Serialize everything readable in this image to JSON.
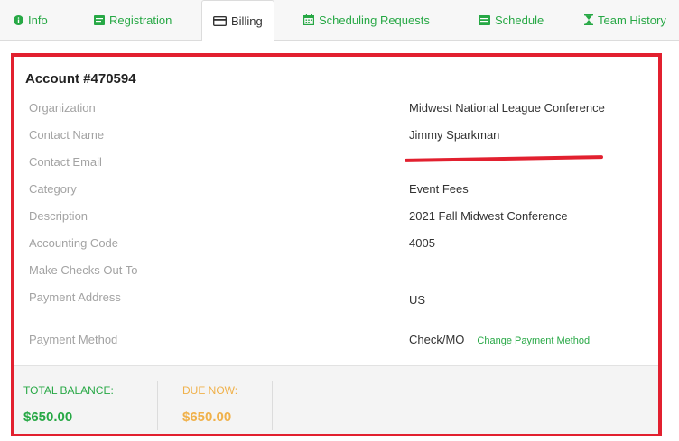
{
  "tabs": [
    {
      "label": "Info",
      "icon": "info-icon"
    },
    {
      "label": "Registration",
      "icon": "registration-icon"
    },
    {
      "label": "Billing",
      "icon": "credit-card-icon",
      "active": true
    },
    {
      "label": "Scheduling Requests",
      "icon": "calendar-icon"
    },
    {
      "label": "Schedule",
      "icon": "schedule-icon"
    },
    {
      "label": "Team History",
      "icon": "hourglass-icon"
    }
  ],
  "account": {
    "title": "Account #470594",
    "rows": [
      {
        "label": "Organization",
        "value": "Midwest National League Conference"
      },
      {
        "label": "Contact Name",
        "value": "Jimmy Sparkman"
      },
      {
        "label": "Contact Email",
        "value": "",
        "redacted": true
      },
      {
        "label": "Category",
        "value": "Event Fees"
      },
      {
        "label": "Description",
        "value": "2021 Fall Midwest Conference"
      },
      {
        "label": "Accounting Code",
        "value": "4005"
      },
      {
        "label": "Make Checks Out To",
        "value": ""
      },
      {
        "label": "Payment Address",
        "value": "US"
      },
      {
        "label": "Payment Method",
        "value": "Check/MO",
        "link": "Change Payment Method"
      }
    ]
  },
  "balance": {
    "total_label": "TOTAL BALANCE:",
    "total_value": "$650.00",
    "due_label": "DUE NOW:",
    "due_value": "$650.00"
  },
  "colors": {
    "accent_green": "#27a845",
    "due_orange": "#f0b14a",
    "highlight_red": "#e2202f"
  }
}
